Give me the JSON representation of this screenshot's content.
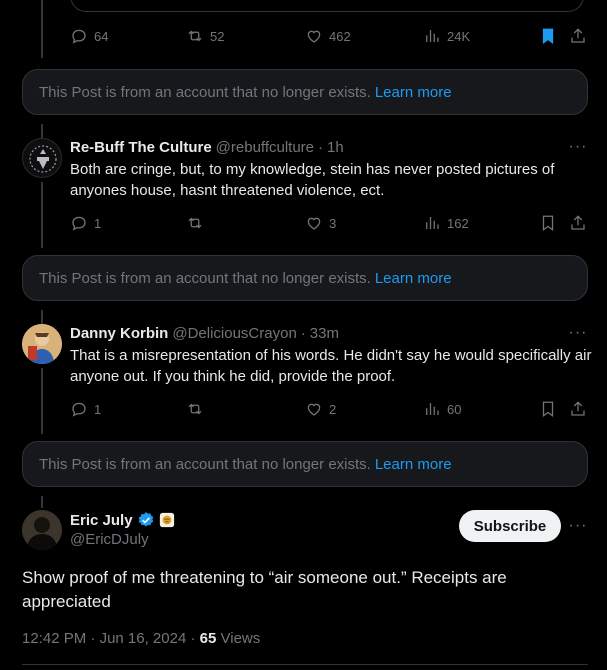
{
  "top_post": {
    "replies": "64",
    "reposts": "52",
    "likes": "462",
    "views": "24K"
  },
  "notice": {
    "text": "This Post is from an account that no longer exists.",
    "link": "Learn more"
  },
  "replies": [
    {
      "name": "Re-Buff The Culture",
      "handle": "@rebuffculture",
      "time": "1h",
      "text": "Both are cringe, but, to my knowledge, stein has never posted pictures of anyones house, hasnt threatened violence, ect.",
      "replies": "1",
      "reposts": "",
      "likes": "3",
      "views": "162"
    },
    {
      "name": "Danny Korbin",
      "handle": "@DeliciousCrayon",
      "time": "33m",
      "text": "That is a misrepresentation of his words. He didn't say he would specifically air anyone out. If you think he did, provide the proof.",
      "replies": "1",
      "reposts": "",
      "likes": "2",
      "views": "60"
    }
  ],
  "main_post": {
    "name": "Eric July",
    "handle": "@EricDJuly",
    "subscribe_label": "Subscribe",
    "text": "Show proof of me threatening to “air someone out.” Receipts are appreciated",
    "time": "12:42 PM",
    "date": "Jun 16, 2024",
    "views_count": "65",
    "views_label": "Views"
  },
  "colors": {
    "accent": "#1d9bf0",
    "muted": "#71767b",
    "text": "#e7e9ea",
    "background": "#000000"
  }
}
